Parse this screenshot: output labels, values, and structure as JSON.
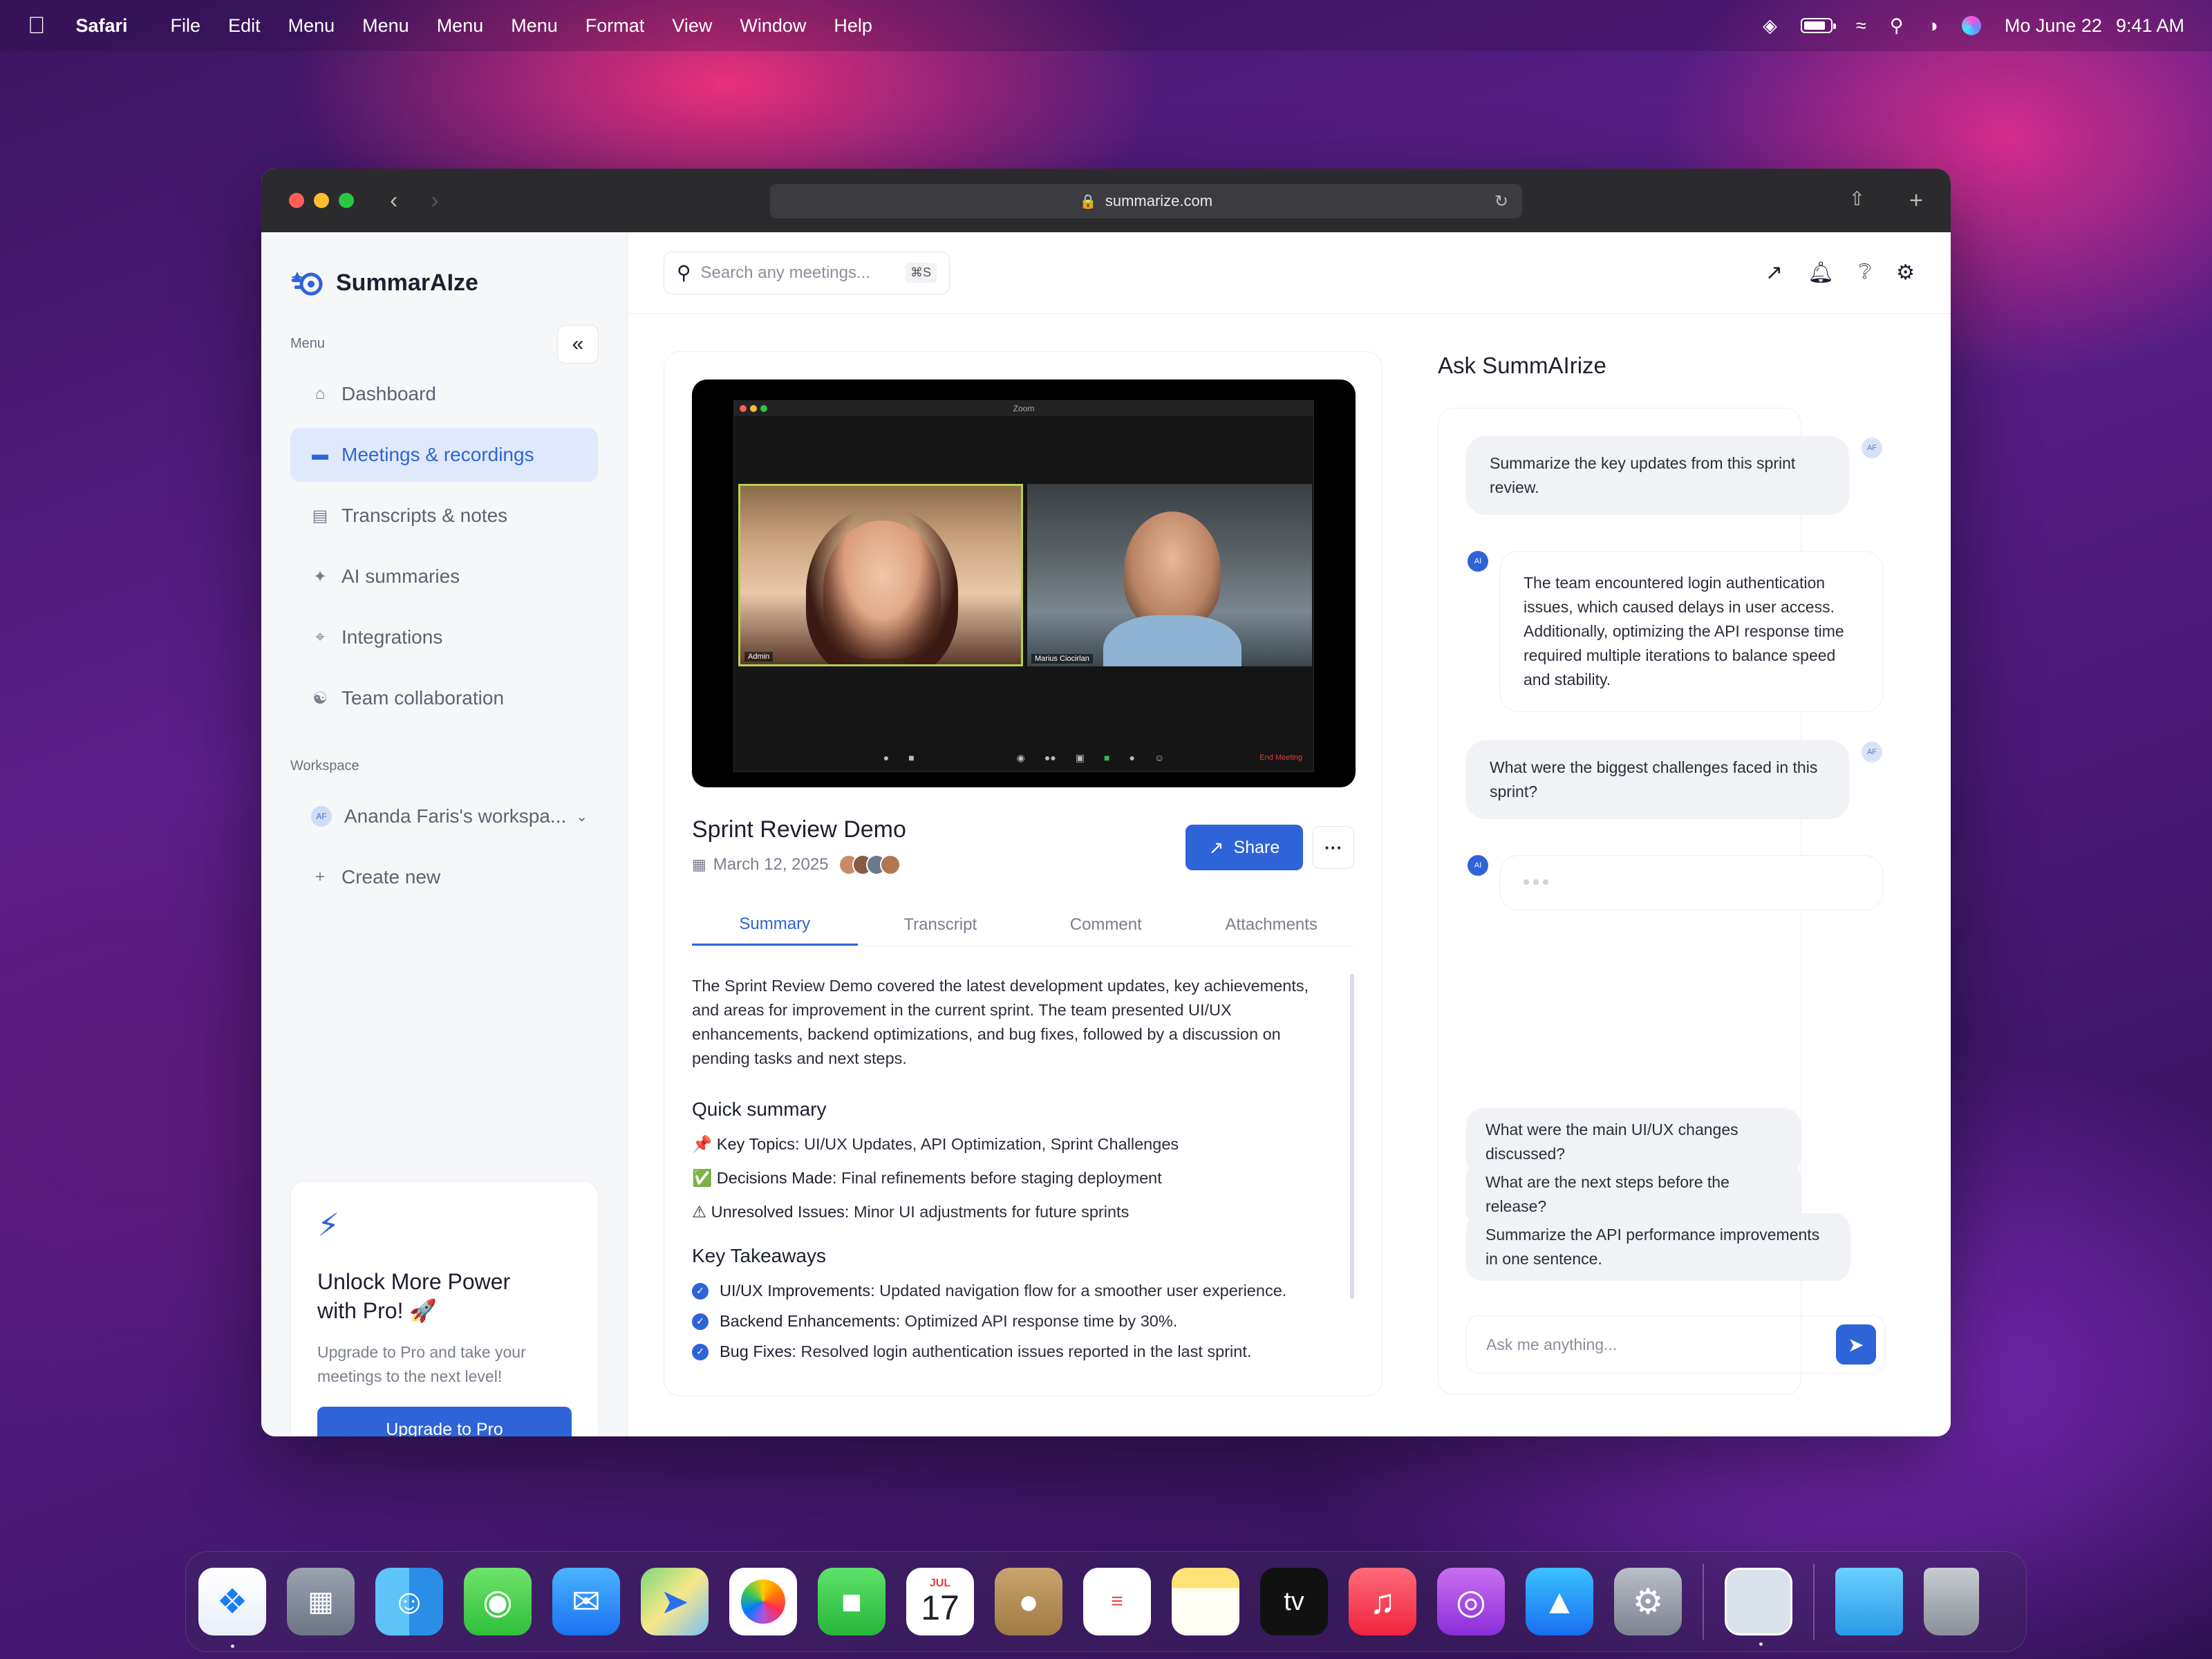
{
  "menubar": {
    "app": "Safari",
    "items": [
      "File",
      "Edit",
      "Menu",
      "Menu",
      "Menu",
      "Menu",
      "Format",
      "View",
      "Window",
      "Help"
    ],
    "date": "Mo June 22",
    "time": "9:41 AM"
  },
  "browser": {
    "url": "summarize.com"
  },
  "sidebar": {
    "brand": "SummarAIze",
    "menu_label": "Menu",
    "items": [
      {
        "label": "Dashboard",
        "icon": "home-icon"
      },
      {
        "label": "Meetings & recordings",
        "icon": "video-icon",
        "active": true
      },
      {
        "label": "Transcripts & notes",
        "icon": "document-icon"
      },
      {
        "label": "AI summaries",
        "icon": "sparkle-icon"
      },
      {
        "label": "Integrations",
        "icon": "integrations-icon"
      },
      {
        "label": "Team collaboration",
        "icon": "team-icon"
      }
    ],
    "workspace_label": "Workspace",
    "workspace_avatar": "AF",
    "workspace_name": "Ananda Faris's workspa...",
    "create_new": "Create new",
    "promo": {
      "title_line1": "Unlock More Power",
      "title_line2": "with Pro! 🚀",
      "desc_line1": "Upgrade to Pro and take your",
      "desc_line2": "meetings to the next level!",
      "button": "Upgrade to Pro"
    }
  },
  "topbar": {
    "search_placeholder": "Search any meetings...",
    "search_shortcut": "⌘S"
  },
  "meeting": {
    "video": {
      "window_title": "Zoom",
      "participant_1": "Admin",
      "participant_2": "Marius Ciocirlan",
      "end_label": "End Meeting"
    },
    "title": "Sprint Review Demo",
    "date": "March 12, 2025",
    "share_label": "Share",
    "more_label": "···",
    "tabs": [
      "Summary",
      "Transcript",
      "Comment",
      "Attachments"
    ],
    "active_tab": "Summary",
    "summary_intro": "The Sprint Review Demo covered the latest development updates, key achievements, and areas for improvement in the current sprint. The team presented UI/UX enhancements, backend optimizations, and bug fixes, followed by a discussion on pending tasks and next steps.",
    "quick_summary_heading": "Quick summary",
    "quick_summary": [
      {
        "emoji": "📌",
        "label": "Key Topics:",
        "text": " UI/UX Updates, API Optimization, Sprint Challenges"
      },
      {
        "emoji": "✅",
        "label": "Decisions Made:",
        "text": " Final refinements before staging deployment"
      },
      {
        "emoji": "⚠",
        "label": "Unresolved Issues:",
        "text": " Minor UI adjustments for future sprints"
      }
    ],
    "takeaways_heading": "Key Takeaways",
    "takeaways": [
      {
        "label": "UI/UX Improvements:",
        "text": " Updated navigation flow for a smoother user experience."
      },
      {
        "label": "Backend Enhancements:",
        "text": " Optimized API response time by 30%."
      },
      {
        "label": "Bug Fixes:",
        "text": " Resolved login authentication issues reported in the last sprint."
      }
    ]
  },
  "chat": {
    "title": "Ask SummAIrize",
    "user_tag": "AF",
    "ai_tag": "AI",
    "messages": [
      {
        "role": "user",
        "text": "Summarize the key updates from this sprint review."
      },
      {
        "role": "bot",
        "text": "The team encountered login authentication issues, which caused delays in user access. Additionally, optimizing the API response time required multiple iterations to balance speed and stability."
      },
      {
        "role": "user",
        "text": "What were the biggest challenges faced in this sprint?"
      }
    ],
    "suggestions": [
      "What were the main UI/UX changes discussed?",
      "What are the next steps before the release?",
      "Summarize the API performance improvements in one sentence."
    ],
    "input_placeholder": "Ask me anything..."
  },
  "dock": {
    "apps": [
      "Safari",
      "Launchpad",
      "Finder",
      "Messages",
      "Mail",
      "Maps",
      "Photos",
      "FaceTime",
      "Calendar",
      "Contacts",
      "Reminders",
      "Notes",
      "TV",
      "Music",
      "Podcasts",
      "App Store",
      "System Settings",
      "Preview",
      "Downloads",
      "Trash"
    ],
    "calendar_month": "JUL",
    "calendar_day": "17",
    "tv_label": "tv"
  }
}
